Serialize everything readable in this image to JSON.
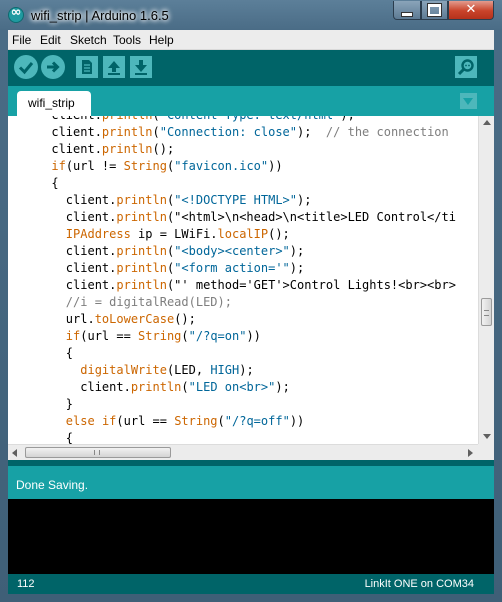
{
  "window": {
    "title": "wifi_strip | Arduino 1.6.5",
    "app_icon": "arduino-logo-icon",
    "controls": {
      "minimize": "minimize-icon",
      "maximize": "maximize-icon",
      "close": "close-icon",
      "close_glyph": "✕"
    }
  },
  "menu": [
    "File",
    "Edit",
    "Sketch",
    "Tools",
    "Help"
  ],
  "toolbar": {
    "buttons": [
      {
        "name": "verify",
        "icon": "checkmark-icon"
      },
      {
        "name": "upload",
        "icon": "right-arrow-icon"
      },
      {
        "name": "new",
        "icon": "new-file-icon"
      },
      {
        "name": "open",
        "icon": "up-arrow-icon"
      },
      {
        "name": "save",
        "icon": "down-arrow-icon"
      }
    ],
    "serial_monitor_icon": "magnifier-icon"
  },
  "tabs": {
    "active": "wifi_strip",
    "menu_icon": "triangle-down-icon"
  },
  "editor": {
    "lines": [
      "      client.println(\"Content-Type: text/html\");",
      "      client.println(\"Connection: close\");  // the connection",
      "      client.println();",
      "      if(url != String(\"favicon.ico\"))",
      "      {",
      "        client.println(\"<!DOCTYPE HTML>\");",
      "        client.println(\"<html>\\n<head>\\n<title>LED Control</ti",
      "        IPAddress ip = LWiFi.localIP();",
      "        client.println(\"<body><center>\");",
      "        client.println(\"<form action='\");",
      "        client.println(\"' method='GET'>Control Lights!<br><br>",
      "        //i = digitalRead(LED);",
      "        url.toLowerCase();",
      "        if(url == String(\"/?q=on\"))",
      "        {",
      "          digitalWrite(LED, HIGH);",
      "          client.println(\"LED on<br>\");",
      "        }",
      "        else if(url == String(\"/?q=off\"))",
      "        {"
    ]
  },
  "colors": {
    "keyword": "#cc6600",
    "string": "#006699",
    "comment": "#7e7e7e",
    "toolbar": "#006468",
    "tab_bar": "#17a1a5",
    "button": "#4db7bb"
  },
  "status": {
    "message": "Done Saving."
  },
  "footer": {
    "line_number": "112",
    "board": "LinkIt ONE on COM34"
  }
}
